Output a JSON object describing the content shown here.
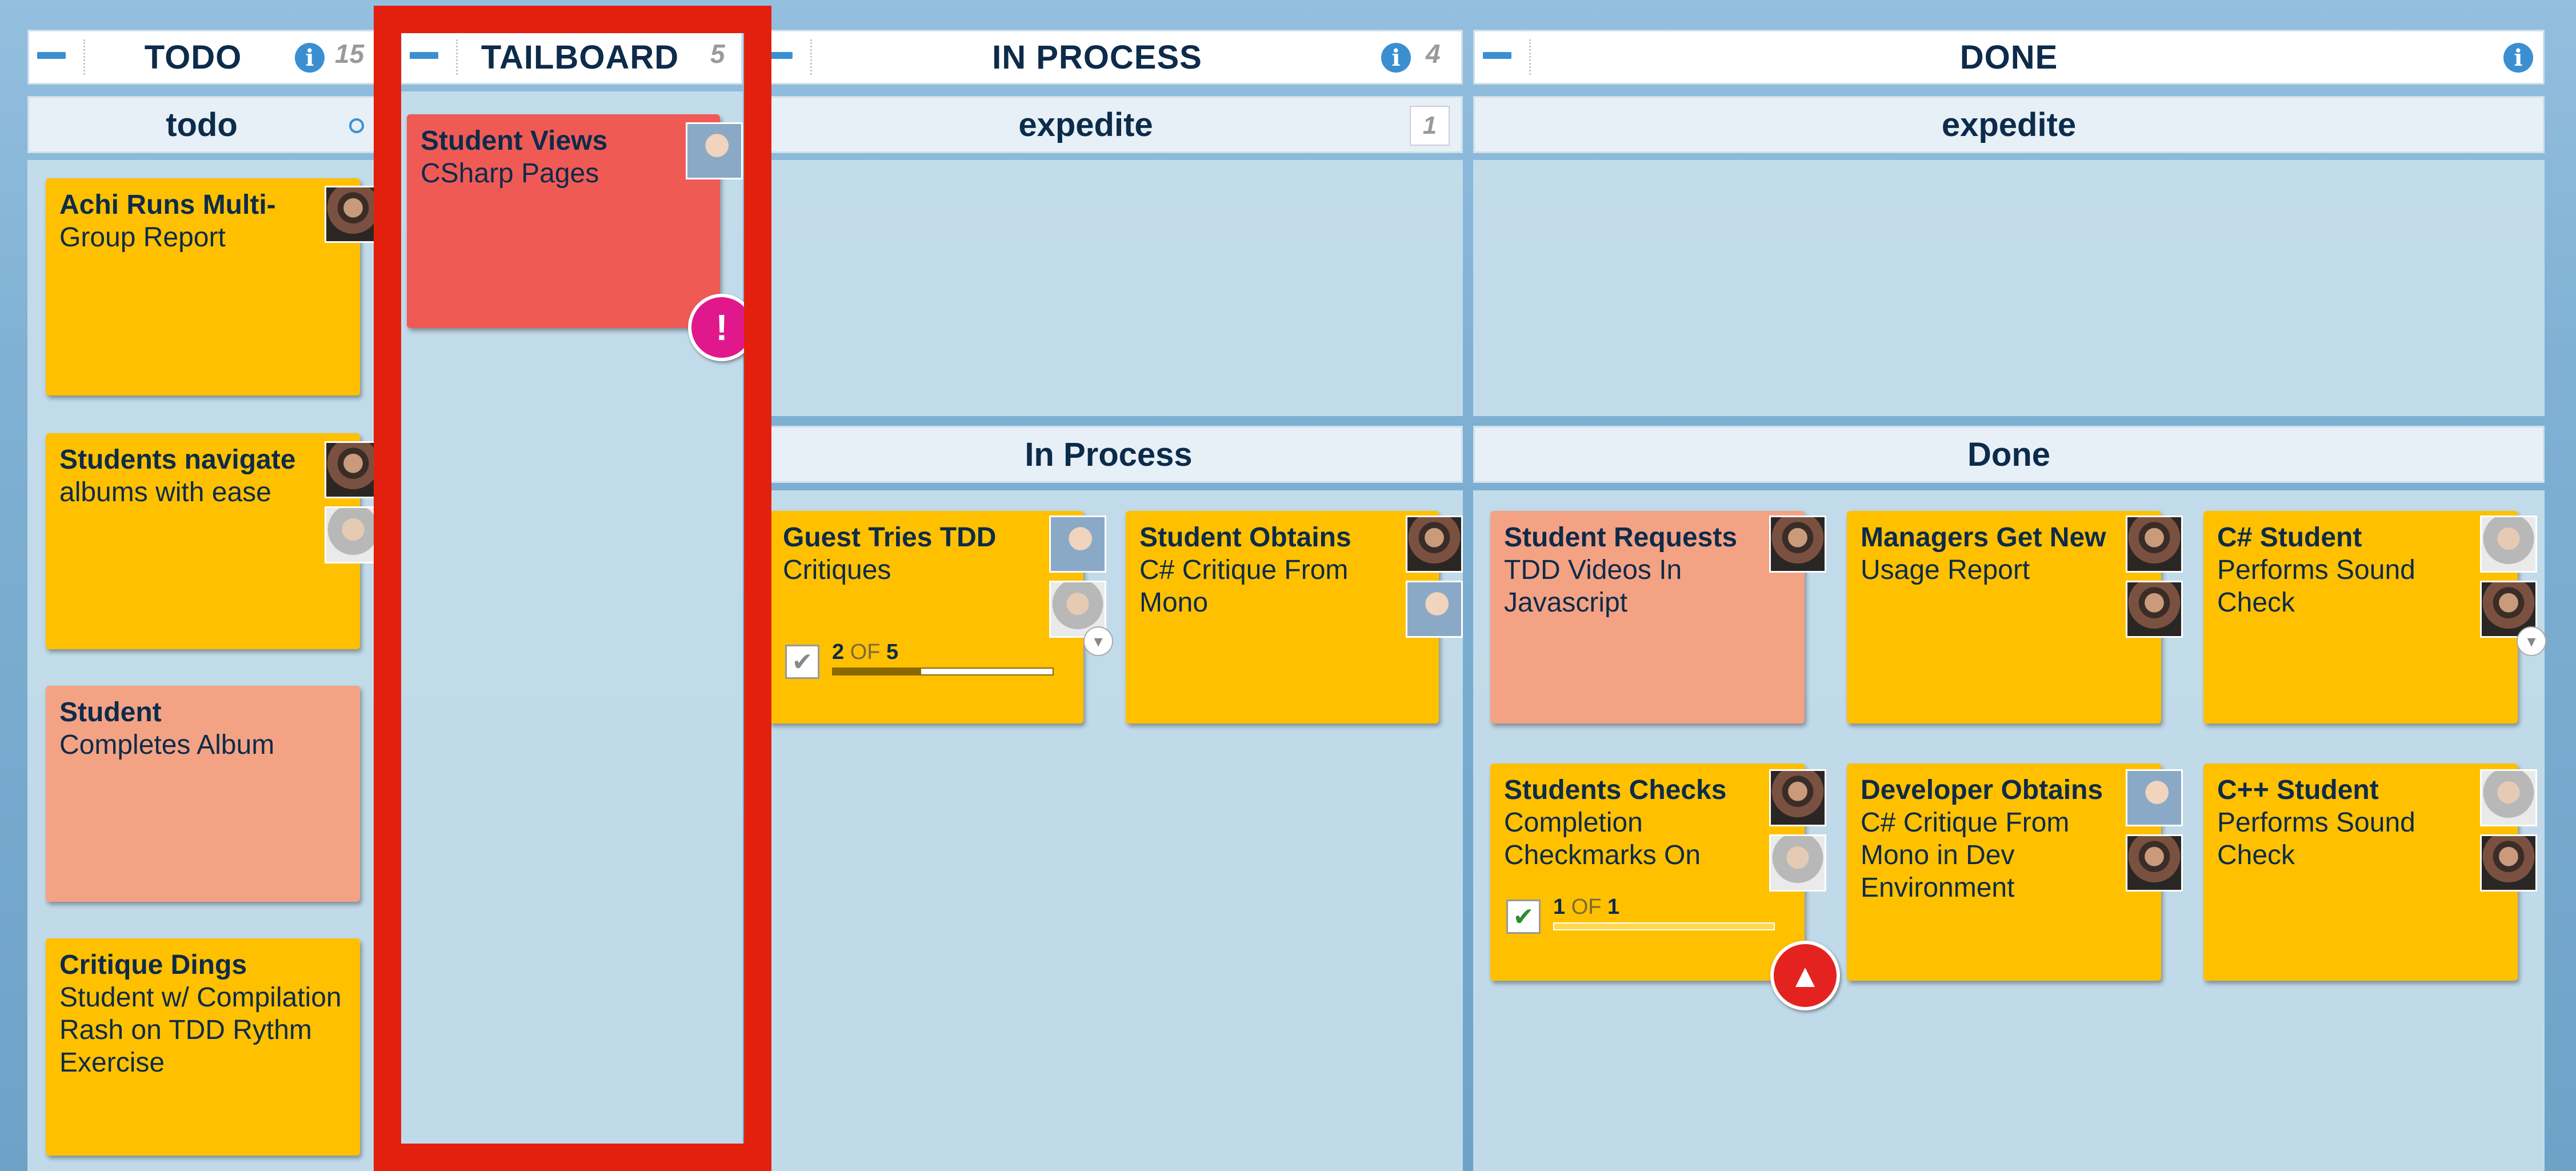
{
  "columns": {
    "todo": {
      "title": "TODO",
      "count": "15"
    },
    "tailboard": {
      "title": "TAILBOARD",
      "count": "5"
    },
    "in_process": {
      "title": "IN PROCESS",
      "count": "4"
    },
    "done": {
      "title": "DONE"
    }
  },
  "lanes": {
    "todo": "todo",
    "expedite_ip": "expedite",
    "expedite_ip_count": "1",
    "expedite_done": "expedite",
    "in_process": "In Process",
    "done": "Done"
  },
  "cards": {
    "todo_1": {
      "title": "Achi Runs Multi-",
      "sub": "Group Report"
    },
    "todo_2": {
      "title": "Students navigate",
      "sub": "albums with ease"
    },
    "todo_3": {
      "title": "Student",
      "sub": "Completes Album"
    },
    "todo_4": {
      "title": "Critique Dings",
      "sub": "Student w/ Compilation Rash on TDD Rythm Exercise"
    },
    "tail_1": {
      "title": "Student Views",
      "sub": "CSharp Pages"
    },
    "ip_1": {
      "title": "Guest Tries TDD",
      "sub": "Critiques",
      "progress_done": "2",
      "progress_of": "OF",
      "progress_total": "5"
    },
    "ip_2": {
      "title": "Student Obtains",
      "sub": "C# Critique From Mono"
    },
    "done_1": {
      "title": "Student Requests",
      "sub": "TDD Videos In Javascript"
    },
    "done_2": {
      "title": "Managers Get New",
      "sub": "Usage Report"
    },
    "done_3": {
      "title": "C# Student",
      "sub": "Performs Sound Check"
    },
    "done_4": {
      "title": "Students Checks",
      "sub": "Completion Checkmarks On",
      "progress_done": "1",
      "progress_of": "OF",
      "progress_total": "1"
    },
    "done_5": {
      "title": "Developer Obtains",
      "sub": "C# Critique From Mono in Dev Environment"
    },
    "done_6": {
      "title": "C++ Student",
      "sub": "Performs Sound Check"
    }
  },
  "progress": {
    "ip_1": 0.4,
    "done_4": 1.0
  },
  "icons": {
    "info": "i",
    "blocked": "!",
    "priority": "▲",
    "check": "✔",
    "dropdown": "▾"
  },
  "colors": {
    "card_yellow": "#ffc000",
    "card_salmon": "#f4a284",
    "card_red": "#f05a55",
    "highlight": "#e2200d",
    "accent": "#3b8fd1"
  }
}
